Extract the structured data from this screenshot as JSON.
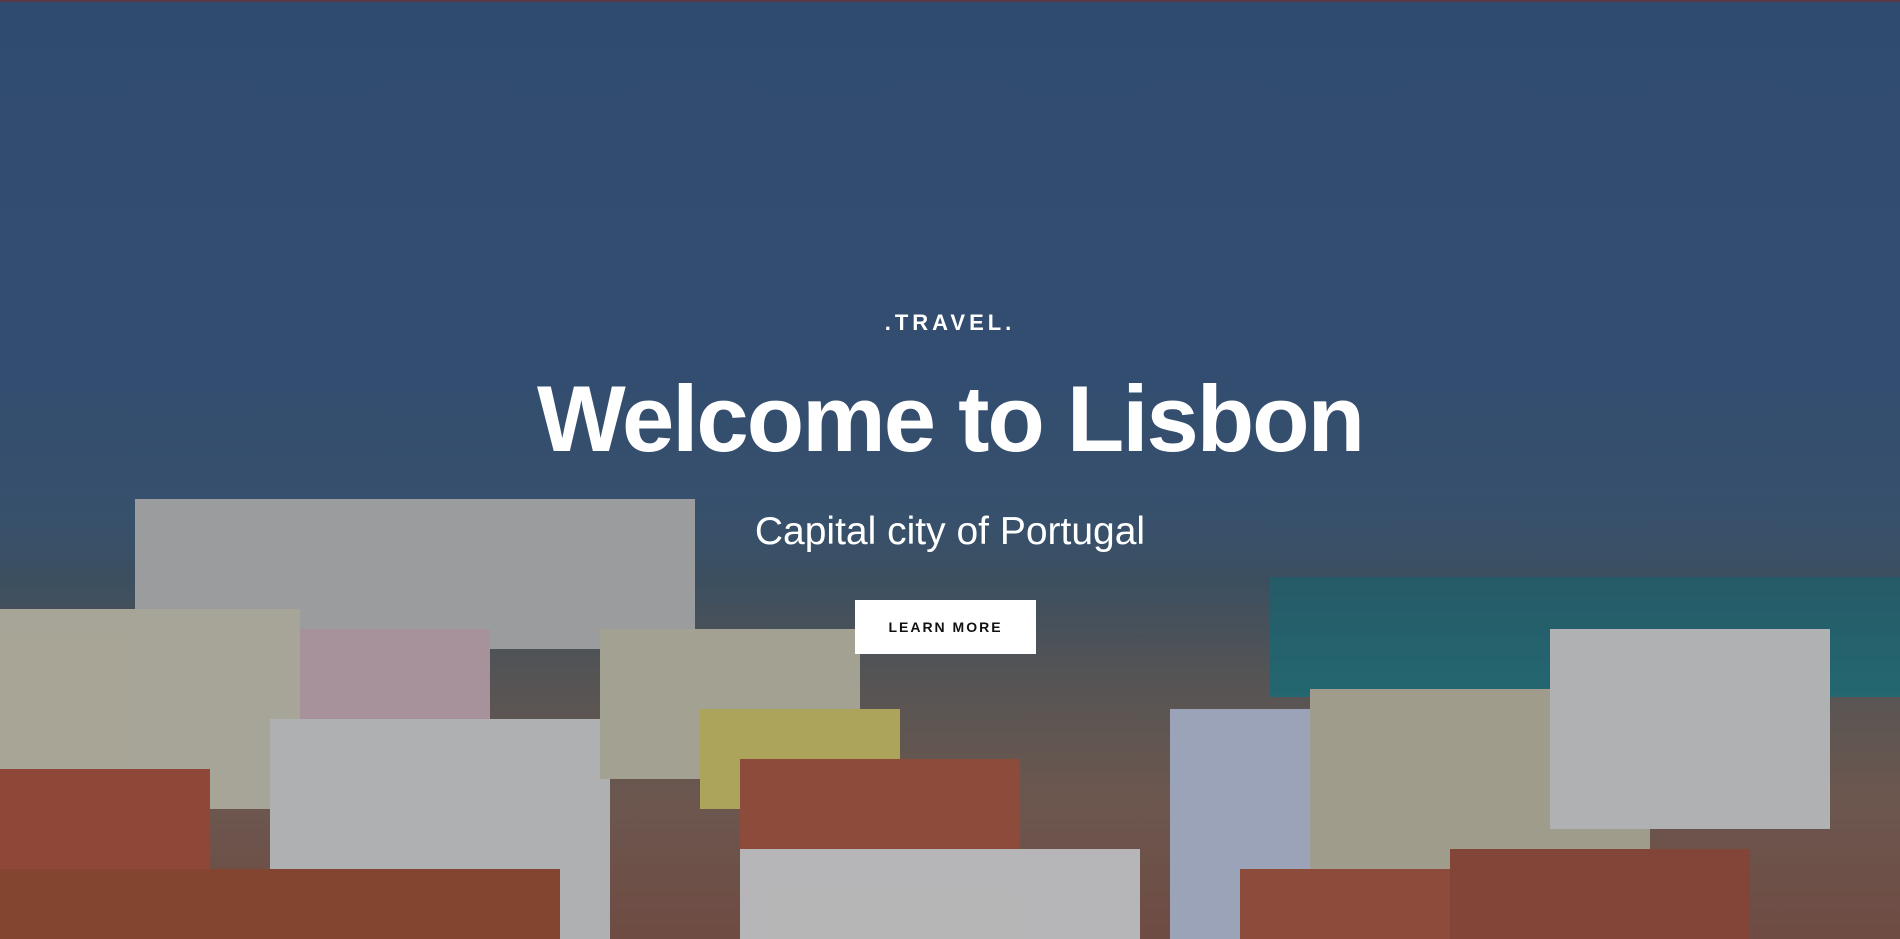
{
  "hero": {
    "kicker": ".TRAVEL.",
    "title": "Welcome to Lisbon",
    "subtitle": "Capital city of Portugal",
    "cta_label": "LEARN MORE",
    "background_image": "lisbon-rooftops-cityscape"
  },
  "colors": {
    "sky": "#3a5a84",
    "roof": "#b5583c",
    "button_bg": "#ffffff",
    "button_text": "#111111"
  }
}
